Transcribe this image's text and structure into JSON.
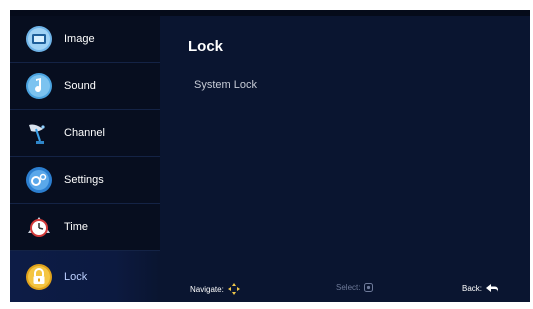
{
  "sidebar": {
    "items": [
      {
        "label": "Image",
        "icon": "image-icon"
      },
      {
        "label": "Sound",
        "icon": "sound-icon"
      },
      {
        "label": "Channel",
        "icon": "satellite-dish-icon"
      },
      {
        "label": "Settings",
        "icon": "settings-icon"
      },
      {
        "label": "Time",
        "icon": "clock-icon"
      },
      {
        "label": "Lock",
        "icon": "lock-icon",
        "selected": true
      }
    ]
  },
  "main": {
    "title": "Lock",
    "options": [
      {
        "label": "System Lock"
      }
    ]
  },
  "footer": {
    "navigate_label": "Navigate:",
    "select_label": "Select:",
    "back_label": "Back:"
  },
  "colors": {
    "background": "#0a1530",
    "sidebar": "#070e1f",
    "active_item": "#0d1c46"
  }
}
